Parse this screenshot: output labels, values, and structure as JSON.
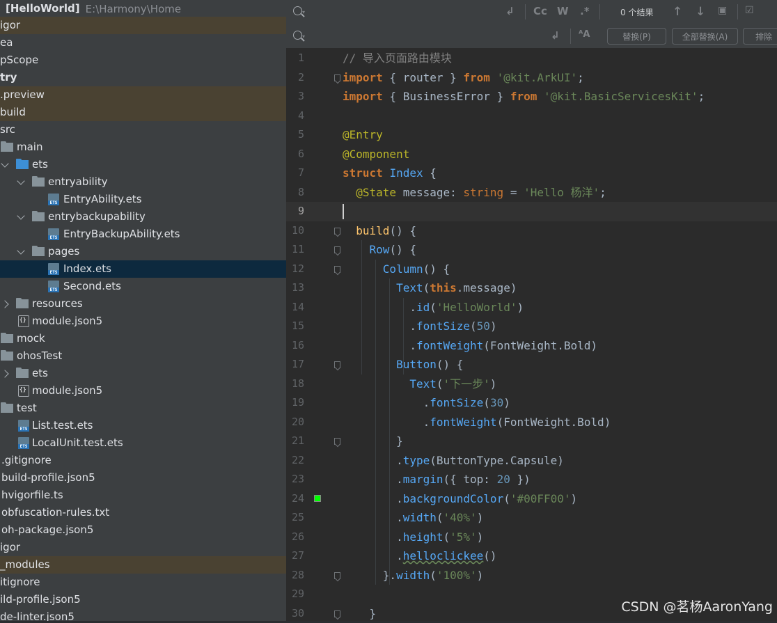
{
  "project_tree": {
    "header": {
      "name": "[HelloWorld]",
      "path": "E:\\Harmony\\Home"
    },
    "items": [
      {
        "label": "igor"
      },
      {
        "label": "ea"
      },
      {
        "label": "pScope"
      },
      {
        "label": "try"
      },
      {
        "label": ".preview"
      },
      {
        "label": "build"
      },
      {
        "label": "src"
      },
      {
        "label": "main"
      },
      {
        "label": "ets"
      },
      {
        "label": "entryability"
      },
      {
        "label": "EntryAbility.ets"
      },
      {
        "label": "entrybackupability"
      },
      {
        "label": "EntryBackupAbility.ets"
      },
      {
        "label": "pages"
      },
      {
        "label": "Index.ets"
      },
      {
        "label": "Second.ets"
      },
      {
        "label": "resources"
      },
      {
        "label": "module.json5"
      },
      {
        "label": "mock"
      },
      {
        "label": "ohosTest"
      },
      {
        "label": "ets"
      },
      {
        "label": "module.json5"
      },
      {
        "label": "test"
      },
      {
        "label": "List.test.ets"
      },
      {
        "label": "LocalUnit.test.ets"
      },
      {
        "label": ".gitignore"
      },
      {
        "label": "build-profile.json5"
      },
      {
        "label": "hvigorfile.ts"
      },
      {
        "label": "obfuscation-rules.txt"
      },
      {
        "label": "oh-package.json5"
      },
      {
        "label": "igor"
      },
      {
        "label": "_modules"
      },
      {
        "label": "itignore"
      },
      {
        "label": "ild-profile.json5"
      },
      {
        "label": "de-linter.json5"
      }
    ]
  },
  "find_replace": {
    "result_count": "0 个结果",
    "case_btn": "Cc",
    "word_btn": "W",
    "regex_btn": ".*",
    "replace_btn": "替换(P)",
    "replace_all_btn": "全部替换(A)",
    "exclude_btn": "排除"
  },
  "editor": {
    "lines": [
      [
        [
          "cm",
          "// 导入页面路由模块"
        ]
      ],
      [
        [
          "kw",
          "import"
        ],
        [
          "pl",
          " { router } "
        ],
        [
          "kw",
          "from"
        ],
        [
          "pl",
          " "
        ],
        [
          "st",
          "'@kit.ArkUI'"
        ],
        [
          "pl",
          ";"
        ]
      ],
      [
        [
          "kw",
          "import"
        ],
        [
          "pl",
          " { BusinessError } "
        ],
        [
          "kw",
          "from"
        ],
        [
          "pl",
          " "
        ],
        [
          "st",
          "'@kit.BasicServicesKit'"
        ],
        [
          "pl",
          ";"
        ]
      ],
      [],
      [
        [
          "an",
          "@Entry"
        ]
      ],
      [
        [
          "an",
          "@Component"
        ]
      ],
      [
        [
          "kw",
          "struct"
        ],
        [
          "pl",
          " "
        ],
        [
          "cp",
          "Index"
        ],
        [
          "pl",
          " {"
        ]
      ],
      [
        [
          "pl",
          "  "
        ],
        [
          "an",
          "@State"
        ],
        [
          "pl",
          " message: "
        ],
        [
          "ty",
          "string"
        ],
        [
          "pl",
          " = "
        ],
        [
          "st",
          "'Hello 杨洋'"
        ],
        [
          "pl",
          ";"
        ]
      ],
      [],
      [
        [
          "pl",
          "  "
        ],
        [
          "fn",
          "build"
        ],
        [
          "pl",
          "() {"
        ]
      ],
      [
        [
          "pl",
          "    "
        ],
        [
          "cp",
          "Row"
        ],
        [
          "pl",
          "() {"
        ]
      ],
      [
        [
          "pl",
          "      "
        ],
        [
          "cp",
          "Column"
        ],
        [
          "pl",
          "() {"
        ]
      ],
      [
        [
          "pl",
          "        "
        ],
        [
          "cp",
          "Text"
        ],
        [
          "pl",
          "("
        ],
        [
          "kw",
          "this"
        ],
        [
          "pl",
          ".message)"
        ]
      ],
      [
        [
          "pl",
          "          ."
        ],
        [
          "cp",
          "id"
        ],
        [
          "pl",
          "("
        ],
        [
          "st",
          "'HelloWorld'"
        ],
        [
          "pl",
          ")"
        ]
      ],
      [
        [
          "pl",
          "          ."
        ],
        [
          "cp",
          "fontSize"
        ],
        [
          "pl",
          "("
        ],
        [
          "nu",
          "50"
        ],
        [
          "pl",
          ")"
        ]
      ],
      [
        [
          "pl",
          "          ."
        ],
        [
          "cp",
          "fontWeight"
        ],
        [
          "pl",
          "(FontWeight.Bold)"
        ]
      ],
      [
        [
          "pl",
          "        "
        ],
        [
          "cp",
          "Button"
        ],
        [
          "pl",
          "() {"
        ]
      ],
      [
        [
          "pl",
          "          "
        ],
        [
          "cp",
          "Text"
        ],
        [
          "pl",
          "("
        ],
        [
          "st",
          "'下一步'"
        ],
        [
          "pl",
          ")"
        ]
      ],
      [
        [
          "pl",
          "            ."
        ],
        [
          "cp",
          "fontSize"
        ],
        [
          "pl",
          "("
        ],
        [
          "nu",
          "30"
        ],
        [
          "pl",
          ")"
        ]
      ],
      [
        [
          "pl",
          "            ."
        ],
        [
          "cp",
          "fontWeight"
        ],
        [
          "pl",
          "(FontWeight.Bold)"
        ]
      ],
      [
        [
          "pl",
          "        }"
        ]
      ],
      [
        [
          "pl",
          "        ."
        ],
        [
          "cp",
          "type"
        ],
        [
          "pl",
          "(ButtonType.Capsule)"
        ]
      ],
      [
        [
          "pl",
          "        ."
        ],
        [
          "cp",
          "margin"
        ],
        [
          "pl",
          "({ top: "
        ],
        [
          "nu",
          "20"
        ],
        [
          "pl",
          " })"
        ]
      ],
      [
        [
          "pl",
          "        ."
        ],
        [
          "cp",
          "backgroundColor"
        ],
        [
          "pl",
          "("
        ],
        [
          "st",
          "'#00FF00'"
        ],
        [
          "pl",
          ")"
        ]
      ],
      [
        [
          "pl",
          "        ."
        ],
        [
          "cp",
          "width"
        ],
        [
          "pl",
          "("
        ],
        [
          "st",
          "'40%'"
        ],
        [
          "pl",
          ")"
        ]
      ],
      [
        [
          "pl",
          "        ."
        ],
        [
          "cp",
          "height"
        ],
        [
          "pl",
          "("
        ],
        [
          "st",
          "'5%'"
        ],
        [
          "pl",
          ")"
        ]
      ],
      [
        [
          "pl",
          "        ."
        ],
        [
          "cp",
          "helloclickee"
        ],
        [
          "pl",
          "()"
        ]
      ],
      [
        [
          "pl",
          "      }."
        ],
        [
          "cp",
          "width"
        ],
        [
          "pl",
          "("
        ],
        [
          "st",
          "'100%'"
        ],
        [
          "pl",
          ")"
        ]
      ],
      [],
      [
        [
          "pl",
          "    }"
        ]
      ]
    ],
    "line_numbers": [
      "1",
      "2",
      "3",
      "4",
      "5",
      "6",
      "7",
      "8",
      "9",
      "10",
      "11",
      "12",
      "13",
      "14",
      "15",
      "16",
      "17",
      "18",
      "19",
      "20",
      "21",
      "22",
      "23",
      "24",
      "25",
      "26",
      "27",
      "28",
      "29",
      "30"
    ]
  },
  "watermark": "CSDN @茗杨AaronYang",
  "colors": {
    "selection": "#0d293e",
    "highlight_row": "#4a4232",
    "color_swatch": "#00FF00"
  }
}
